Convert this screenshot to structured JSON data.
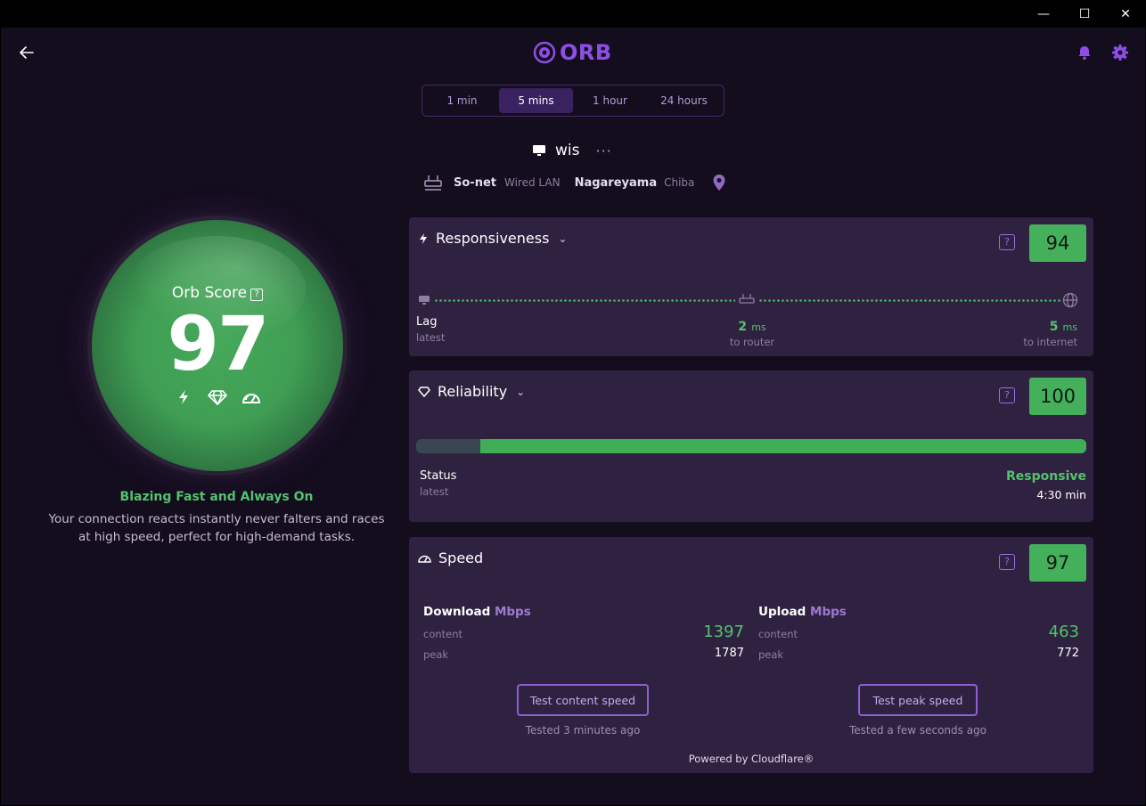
{
  "app": {
    "logo_text": "ORB"
  },
  "window": {
    "min": "—",
    "max": "☐",
    "close": "✕"
  },
  "header": {
    "back_icon": "arrow-left-icon",
    "bell_icon": "bell-icon",
    "gear_icon": "gear-icon"
  },
  "range_tabs": [
    {
      "label": "1 min",
      "active": false
    },
    {
      "label": "5 mins",
      "active": true
    },
    {
      "label": "1 hour",
      "active": false
    },
    {
      "label": "24 hours",
      "active": false
    }
  ],
  "device": {
    "name": "wis",
    "more": "···"
  },
  "network": {
    "isp": "So-net",
    "type": "Wired LAN",
    "city": "Nagareyama",
    "region": "Chiba"
  },
  "orb": {
    "title": "Orb Score",
    "score": "97",
    "help": "?"
  },
  "summary": {
    "tagline": "Blazing Fast and Always On",
    "description": "Your connection reacts instantly never falters and races at high speed, perfect for high-demand tasks."
  },
  "responsiveness": {
    "title": "Responsiveness",
    "score": "94",
    "help": "?",
    "lag_label": "Lag",
    "lag_sub": "latest",
    "router_value": "2",
    "router_unit": "ms",
    "router_sub": "to router",
    "internet_value": "5",
    "internet_unit": "ms",
    "internet_sub": "to internet"
  },
  "reliability": {
    "title": "Reliability",
    "score": "100",
    "help": "?",
    "status_label": "Status",
    "status_sub": "latest",
    "status_value": "Responsive",
    "status_time": "4:30 min",
    "fill_fraction": 0.904
  },
  "speed": {
    "title": "Speed",
    "score": "97",
    "help": "?",
    "download_title": "Download",
    "download_unit": "Mbps",
    "upload_title": "Upload",
    "upload_unit": "Mbps",
    "content_label": "content",
    "peak_label": "peak",
    "download_content": "1397",
    "download_peak": "1787",
    "upload_content": "463",
    "upload_peak": "772",
    "btn_content": "Test content speed",
    "btn_peak": "Test peak speed",
    "tested_content": "Tested 3 minutes ago",
    "tested_peak": "Tested a few seconds ago",
    "powered": "Powered by Cloudflare®"
  }
}
